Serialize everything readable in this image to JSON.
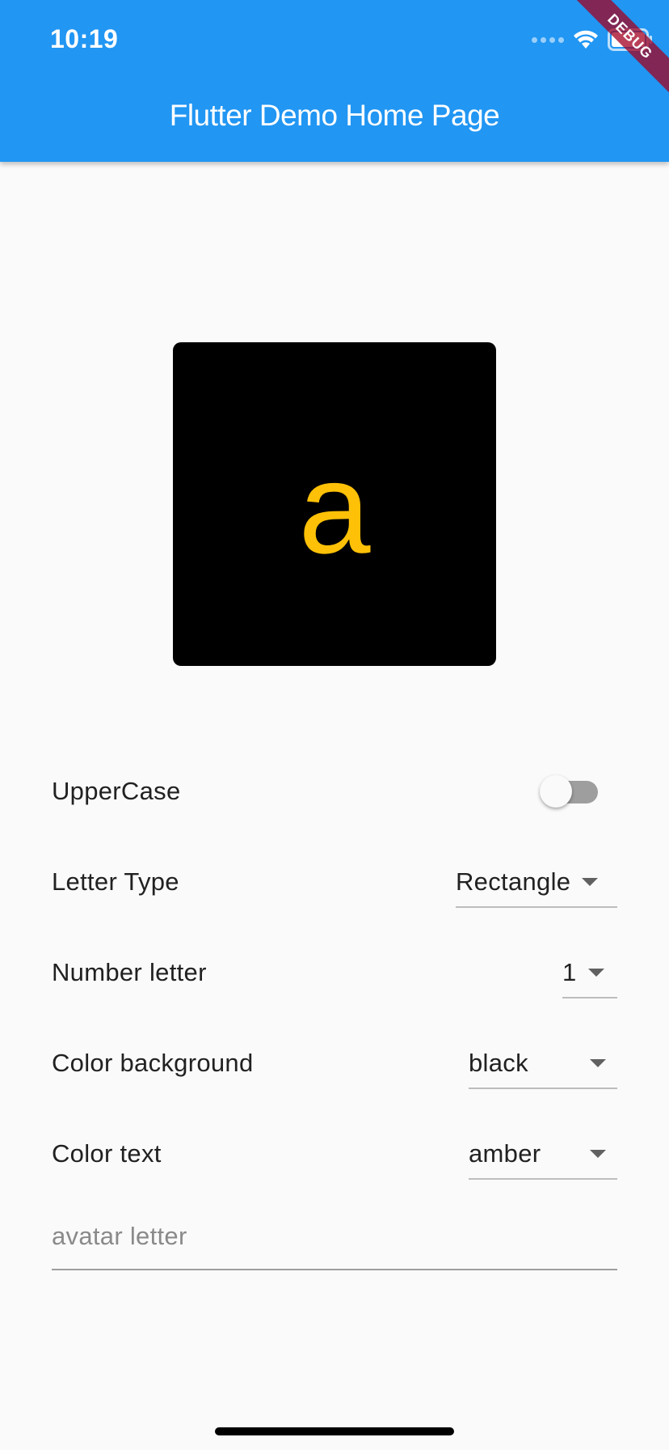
{
  "status_bar": {
    "time": "10:19",
    "signal_icon": "signal-dots-icon",
    "wifi_icon": "wifi-icon",
    "battery_icon": "battery-icon"
  },
  "debug_banner": "DEBUG",
  "app_bar": {
    "title": "Flutter Demo Home Page",
    "color": "#2196f3"
  },
  "avatar": {
    "letter": "a",
    "background_color": "#000000",
    "text_color": "#ffc107"
  },
  "settings": {
    "uppercase": {
      "label": "UpperCase",
      "enabled": false
    },
    "letter_type": {
      "label": "Letter Type",
      "value": "Rectangle"
    },
    "number_letter": {
      "label": "Number letter",
      "value": "1"
    },
    "color_background": {
      "label": "Color background",
      "value": "black"
    },
    "color_text": {
      "label": "Color text",
      "value": "amber"
    }
  },
  "avatar_input": {
    "placeholder": "avatar letter",
    "value": ""
  }
}
